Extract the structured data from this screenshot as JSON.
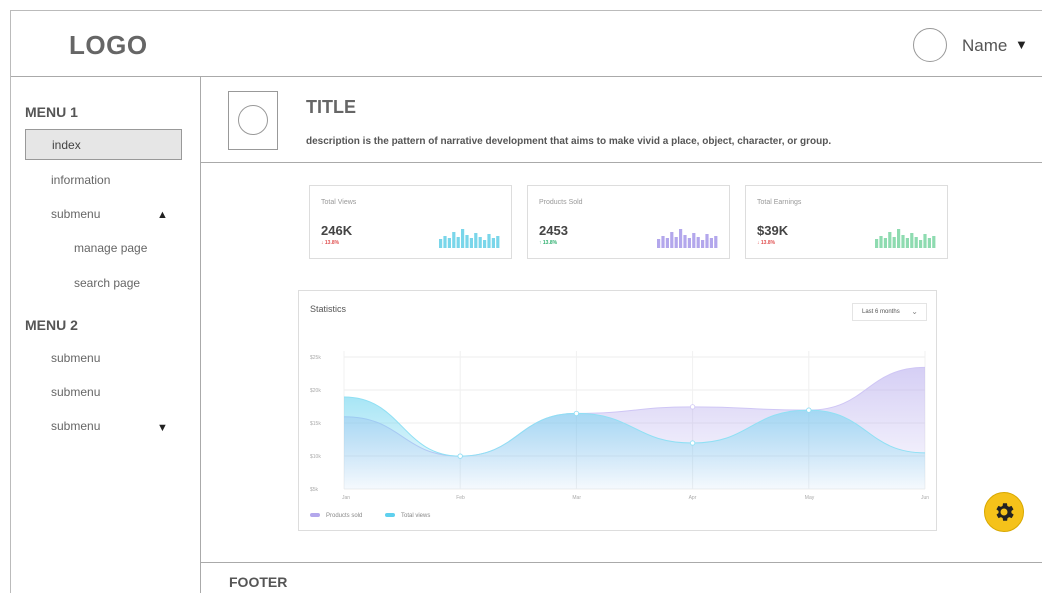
{
  "header": {
    "logo": "LOGO",
    "user_name": "Name",
    "caret": "▼"
  },
  "sidebar": {
    "menu1_title": "MENU 1",
    "menu1_items": [
      "index",
      "information",
      "submenu",
      "manage page",
      "search page"
    ],
    "menu1_expanded_arrow": "▲",
    "menu2_title": "MENU 2",
    "menu2_items": [
      "submenu",
      "submenu",
      "submenu"
    ],
    "menu2_collapsed_arrow": "▼"
  },
  "page": {
    "title": "TITLE",
    "description": "description is the pattern of narrative development that aims to make vivid a place, object, character, or group."
  },
  "cards": [
    {
      "label": "Total Views",
      "value": "246K",
      "change": "↓ 13.8%",
      "trend": "down",
      "color": "#7ad6ea"
    },
    {
      "label": "Products Sold",
      "value": "2453",
      "change": "↑ 13.8%",
      "trend": "up",
      "color": "#b3a7ec"
    },
    {
      "label": "Total Earnings",
      "value": "$39K",
      "change": "↓ 13.8%",
      "trend": "down",
      "color": "#8edbb0"
    }
  ],
  "statistics": {
    "title": "Statistics",
    "range": "Last 6 months",
    "legend": [
      {
        "label": "Products sold",
        "color": "#b3a7ec"
      },
      {
        "label": "Total views",
        "color": "#5fd0ee"
      }
    ]
  },
  "chart_data": {
    "type": "area",
    "categories": [
      "Jan",
      "Feb",
      "Mar",
      "Apr",
      "May",
      "Jun"
    ],
    "y_ticks": [
      "$25k",
      "$20k",
      "$15k",
      "$10k",
      "$5k"
    ],
    "ylim": [
      5,
      26
    ],
    "series": [
      {
        "name": "Products sold",
        "values": [
          16,
          10,
          16.5,
          17.5,
          17,
          23.5
        ]
      },
      {
        "name": "Total views",
        "values": [
          19,
          10,
          16.5,
          12,
          17,
          10.5
        ]
      }
    ],
    "grid": true,
    "legend_position": "bottom-left"
  },
  "footer": {
    "label": "FOOTER"
  }
}
